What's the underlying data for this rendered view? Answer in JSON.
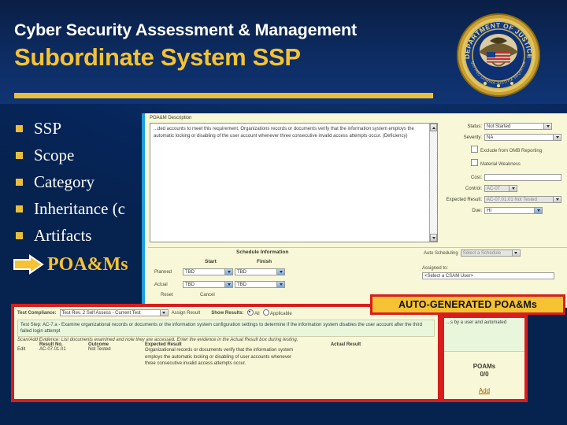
{
  "slide": {
    "eyebrow": "Cyber Security Assessment & Management",
    "title": "Subordinate System SSP",
    "seal_text_top": "DEPARTMENT OF JUSTICE",
    "seal_text_bottom": "QUI PRO DOMINA JUSTITIA SEQUITUR"
  },
  "bullets": [
    {
      "label": "SSP"
    },
    {
      "label": "Scope"
    },
    {
      "label": "Category"
    },
    {
      "label": "Inheritance (c"
    },
    {
      "label": "Artifacts"
    }
  ],
  "current_bullet": {
    "label": "POA&Ms"
  },
  "banner": {
    "label": "AUTO-GENERATED POA&Ms"
  },
  "poam_form": {
    "description_caption": "POA&M Description",
    "description_text": "...ded accounts to meet this requirement. Organizations records or documents verify that the information system employs the automatic locking or disabling of the user account whenever three consecutive invalid access attempts occur. (Deficiency)",
    "fields": [
      {
        "label": "Status:",
        "value": "Not Started",
        "type": "combo"
      },
      {
        "label": "Severity:",
        "value": "NA",
        "type": "combo"
      }
    ],
    "checkboxes": [
      {
        "label": "Exclude from OMB Reporting",
        "checked": false
      },
      {
        "label": "Material Weakness",
        "checked": false
      }
    ],
    "cost": {
      "label": "Cost:",
      "value": ""
    },
    "control": {
      "label": "Control:",
      "value": "AC-07",
      "disabled": true
    },
    "expected_result": {
      "label": "Expected Result:",
      "value": "AC-07.01.01 Not Tested",
      "disabled": true
    },
    "due": {
      "label": "Due:",
      "value": "HI"
    }
  },
  "schedule": {
    "caption": "Schedule Information",
    "col_start": "Start",
    "col_finish": "Finish",
    "auto_label": "Auto Scheduling",
    "auto_value": "Select a Schedule",
    "assigned_label": "Assigned to:",
    "assigned_value": "<Select a CSAM User>",
    "rows": [
      {
        "label": "Planned",
        "start": "TBD",
        "finish": "TBD"
      },
      {
        "label": "Actual",
        "start": "TBD",
        "finish": "TBD"
      }
    ],
    "buttons": [
      "Reset",
      "Cancel"
    ]
  },
  "test_panel": {
    "compliance_label": "Test Compliance:",
    "compliance_value": "Test Rev. 2 Self Assess - Current Test",
    "assign_label": "Assign Result",
    "show_results_label": "Show Results:",
    "radios": [
      {
        "label": "All",
        "selected": true
      },
      {
        "label": "Applicable",
        "selected": false
      }
    ],
    "test_step": "Test Step:  AC-7.a  -  Examine organizational records or documents or the information system configuration settings to determine if the information system disables the user account after the third failed login attempt",
    "evidence_note": "Scan/Add Evidence: List documents examined and note they are accessed.  Enter the evidence in the Actual Result box during testing.",
    "columns": [
      "",
      "Result No.",
      "Outcome",
      "Expected Result",
      "Actual Result"
    ],
    "rows": [
      {
        "expand": "Edit",
        "result_no": "AC-07.01.01",
        "outcome": "Not Tested",
        "expected_result": "Organizational records or documents verify that the information system employs the automatic locking or disabling of user accounts whenever three consecutive invalid access attempts occur.",
        "actual_result": "...s by a user and automated"
      }
    ]
  },
  "poams_side": {
    "note": "...s by a user and automated",
    "title": "POAMs",
    "count": "0/0",
    "add_link": "Add"
  },
  "colors": {
    "slide_bg": "#0a3b97",
    "gold": "#f5c233",
    "accent_red": "#d81d1d",
    "panel_bg": "#f8f8d8",
    "green_bg": "#e8f6dc",
    "cyan_rule": "#1f9fd8"
  }
}
